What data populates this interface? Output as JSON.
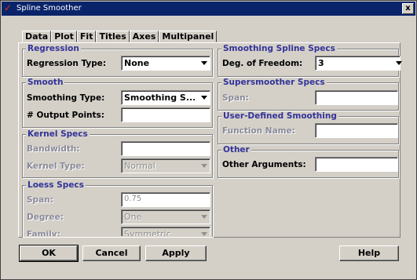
{
  "window": {
    "title": "Spline Smoother",
    "close_label": "x"
  },
  "tabs": [
    {
      "label": "Data"
    },
    {
      "label": "Plot"
    },
    {
      "label": "Fit"
    },
    {
      "label": "Titles"
    },
    {
      "label": "Axes"
    },
    {
      "label": "Multipanel"
    }
  ],
  "regression": {
    "title": "Regression",
    "type_label": "Regression Type:",
    "type_value": "None"
  },
  "smooth": {
    "title": "Smooth",
    "type_label": "Smoothing Type:",
    "type_value": "Smoothing S...",
    "output_points_label": "# Output Points:",
    "output_points_value": ""
  },
  "kernel": {
    "title": "Kernel Specs",
    "bandwidth_label": "Bandwidth:",
    "bandwidth_value": "",
    "type_label": "Kernel Type:",
    "type_value": "Normal"
  },
  "loess": {
    "title": "Loess Specs",
    "span_label": "Span:",
    "span_value": "0.75",
    "degree_label": "Degree:",
    "degree_value": "One",
    "family_label": "Family:",
    "family_value": "Symmetric"
  },
  "spline": {
    "title": "Smoothing Spline Specs",
    "dof_label": "Deg. of Freedom:",
    "dof_value": "3"
  },
  "supersmoother": {
    "title": "Supersmoother Specs",
    "span_label": "Span:",
    "span_value": ""
  },
  "user_defined": {
    "title": "User-Defined Smoothing",
    "function_label": "Function Name:",
    "function_value": ""
  },
  "other": {
    "title": "Other",
    "args_label": "Other Arguments:",
    "args_value": ""
  },
  "buttons": {
    "ok": "OK",
    "cancel": "Cancel",
    "apply": "Apply",
    "help": "Help"
  }
}
